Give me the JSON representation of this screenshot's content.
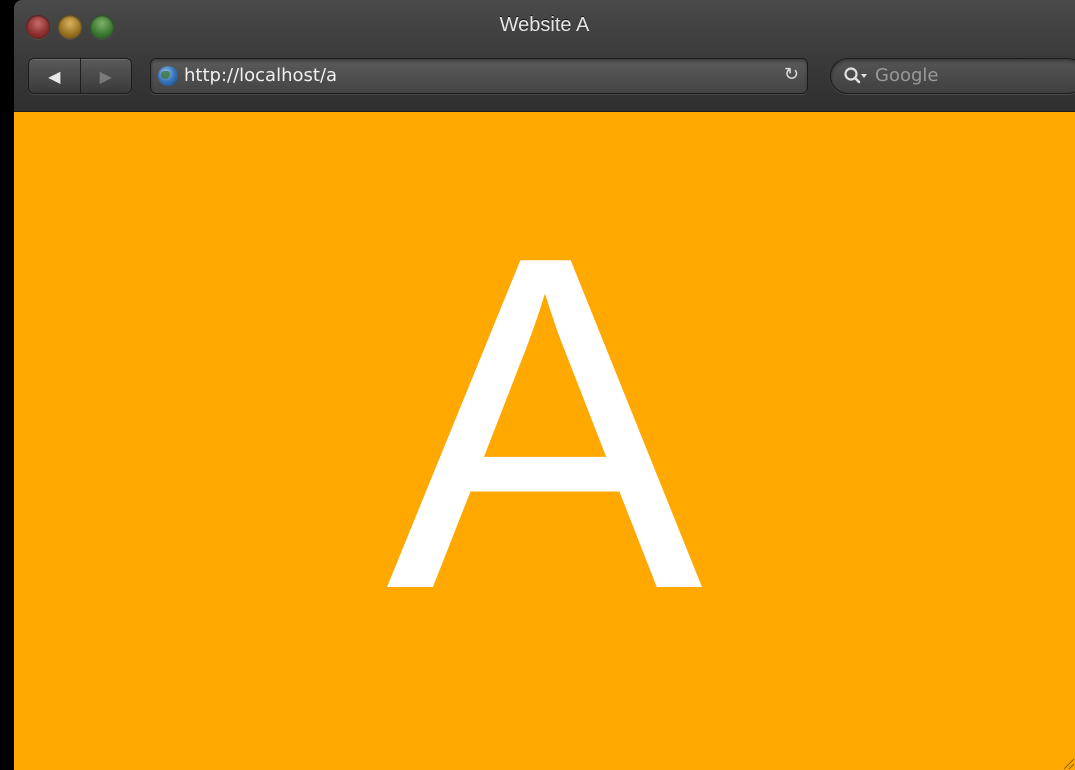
{
  "window": {
    "title": "Website A"
  },
  "navigation": {
    "back_glyph": "◀",
    "forward_glyph": "▶"
  },
  "address_bar": {
    "url": "http://localhost/a",
    "reload_glyph": "↻"
  },
  "search": {
    "placeholder": "Google"
  },
  "page": {
    "letter": "A",
    "background_color": "#FFA800",
    "text_color": "#FFFFFF"
  },
  "icons": {
    "close": "close-icon",
    "minimize": "minimize-icon",
    "zoom": "zoom-icon",
    "site": "globe-icon",
    "search": "search-icon",
    "resize": "resize-grip-icon"
  }
}
